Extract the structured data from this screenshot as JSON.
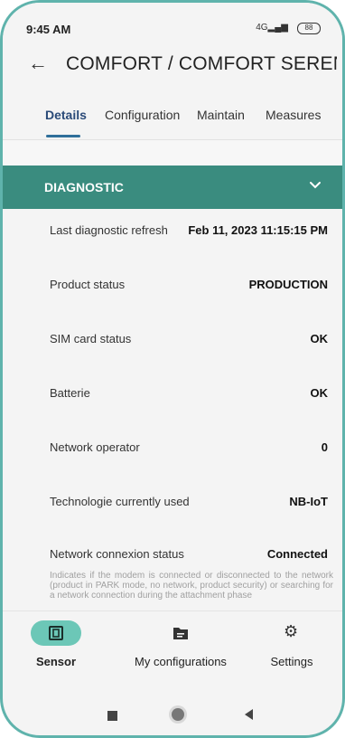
{
  "status_bar": {
    "time": "9:45 AM",
    "signal": "4G",
    "battery": "88"
  },
  "app_bar": {
    "title": "COMFORT / COMFORT SERENI..."
  },
  "tabs": [
    {
      "label": "Details",
      "active": true
    },
    {
      "label": "Configuration",
      "active": false
    },
    {
      "label": "Maintain",
      "active": false
    },
    {
      "label": "Measures",
      "active": false
    }
  ],
  "section": {
    "title": "DIAGNOSTIC"
  },
  "rows": [
    {
      "label": "Last diagnostic refresh",
      "value": "Feb 11, 2023 11:15:15 PM"
    },
    {
      "label": "Product status",
      "value": "PRODUCTION"
    },
    {
      "label": "SIM card status",
      "value": "OK"
    },
    {
      "label": "Batterie",
      "value": "OK"
    },
    {
      "label": "Network operator",
      "value": "0"
    },
    {
      "label": "Technologie currently used",
      "value": "NB-IoT"
    },
    {
      "label": "Network connexion status",
      "value": "Connected",
      "description": "Indicates if the modem is connected or disconnected to the network (product in PARK mode, no network, product security) or searching for a network connection during the attachment phase"
    }
  ],
  "bottom_nav": [
    {
      "label": "Sensor",
      "icon": "sensor-icon",
      "active": true
    },
    {
      "label": "My configurations",
      "icon": "folder-icon",
      "active": false
    },
    {
      "label": "Settings",
      "icon": "gear-icon",
      "active": false
    }
  ],
  "colors": {
    "accent": "#3a8c7f",
    "active_pill": "#6cc7b7",
    "frame": "#5fb3ac",
    "tab_active": "#2a4a78"
  }
}
